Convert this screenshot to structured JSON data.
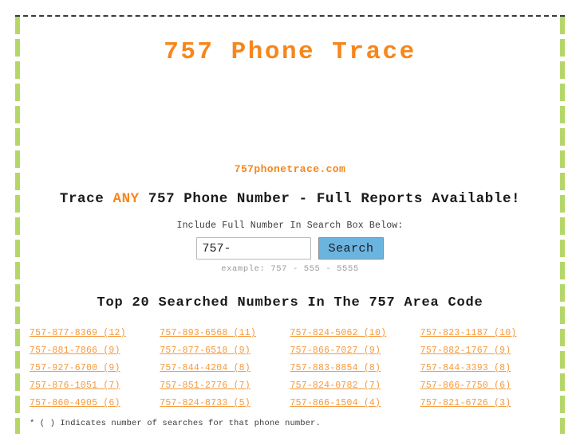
{
  "site": {
    "title": "757 Phone Trace",
    "domain": "757phonetrace.com",
    "tagline_before": "Trace ",
    "tagline_highlight": "ANY",
    "tagline_after": " 757 Phone Number - Full Reports Available!",
    "accent_color": "#f7861b",
    "link_color": "#f79a3c",
    "rail_color": "#b5d76a",
    "button_color": "#6cb4e0"
  },
  "search": {
    "label": "Include Full Number In Search Box Below:",
    "value": "757-",
    "placeholder": "757-",
    "button_label": "Search",
    "example": "example: 757 - 555 - 5555"
  },
  "top_numbers": {
    "heading": "Top 20 Searched Numbers In The 757 Area Code",
    "footnote": "* ( ) Indicates number of searches for that phone number.",
    "items": [
      "757-877-8369  (12)",
      "757-893-6568  (11)",
      "757-824-5062  (10)",
      "757-823-1187  (10)",
      "757-881-7866  (9)",
      "757-877-6518  (9)",
      "757-866-7027  (9)",
      "757-882-1767  (9)",
      "757-927-6700  (9)",
      "757-844-4204  (8)",
      "757-883-8854  (8)",
      "757-844-3393  (8)",
      "757-876-1051  (7)",
      "757-851-2776  (7)",
      "757-824-0782  (7)",
      "757-866-7750  (6)",
      "757-860-4905  (6)",
      "757-824-8733  (5)",
      "757-866-1504  (4)",
      "757-821-6726  (3)"
    ]
  }
}
